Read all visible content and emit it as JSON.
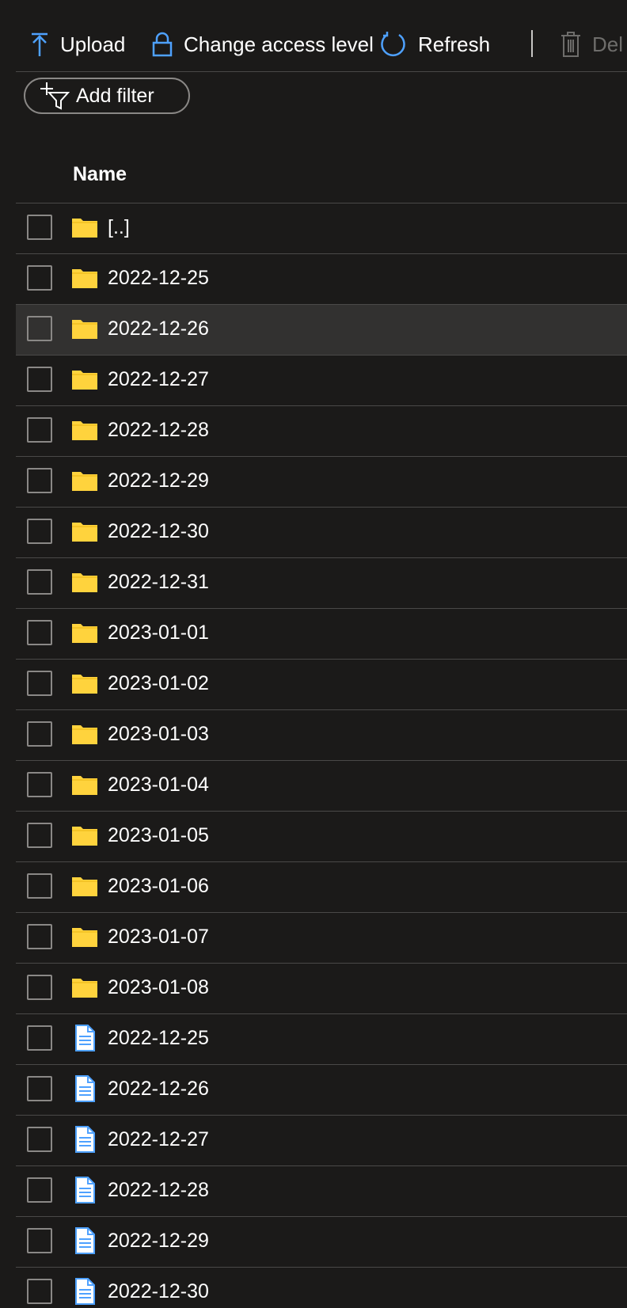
{
  "toolbar": {
    "upload_label": "Upload",
    "access_label": "Change access level",
    "refresh_label": "Refresh",
    "delete_label": "Del"
  },
  "filter": {
    "label": "Add filter"
  },
  "table": {
    "name_header": "Name"
  },
  "rows": [
    {
      "type": "folder",
      "label": "[..]"
    },
    {
      "type": "folder",
      "label": "2022-12-25"
    },
    {
      "type": "folder",
      "label": "2022-12-26",
      "selected": true
    },
    {
      "type": "folder",
      "label": "2022-12-27"
    },
    {
      "type": "folder",
      "label": "2022-12-28"
    },
    {
      "type": "folder",
      "label": "2022-12-29"
    },
    {
      "type": "folder",
      "label": "2022-12-30"
    },
    {
      "type": "folder",
      "label": "2022-12-31"
    },
    {
      "type": "folder",
      "label": "2023-01-01"
    },
    {
      "type": "folder",
      "label": "2023-01-02"
    },
    {
      "type": "folder",
      "label": "2023-01-03"
    },
    {
      "type": "folder",
      "label": "2023-01-04"
    },
    {
      "type": "folder",
      "label": "2023-01-05"
    },
    {
      "type": "folder",
      "label": "2023-01-06"
    },
    {
      "type": "folder",
      "label": "2023-01-07"
    },
    {
      "type": "folder",
      "label": "2023-01-08"
    },
    {
      "type": "file",
      "label": "2022-12-25"
    },
    {
      "type": "file",
      "label": "2022-12-26"
    },
    {
      "type": "file",
      "label": "2022-12-27"
    },
    {
      "type": "file",
      "label": "2022-12-28"
    },
    {
      "type": "file",
      "label": "2022-12-29"
    },
    {
      "type": "file",
      "label": "2022-12-30"
    }
  ],
  "icons": {
    "upload": "upload-arrow-icon",
    "access": "lock-icon",
    "refresh": "refresh-icon",
    "delete": "trash-icon",
    "filter": "add-filter-icon",
    "folder": "folder-icon",
    "file": "document-icon"
  },
  "colors": {
    "background": "#1b1a19",
    "accent": "#4ea1ff",
    "folder": "#ffd33d",
    "selected_row": "#323130"
  }
}
